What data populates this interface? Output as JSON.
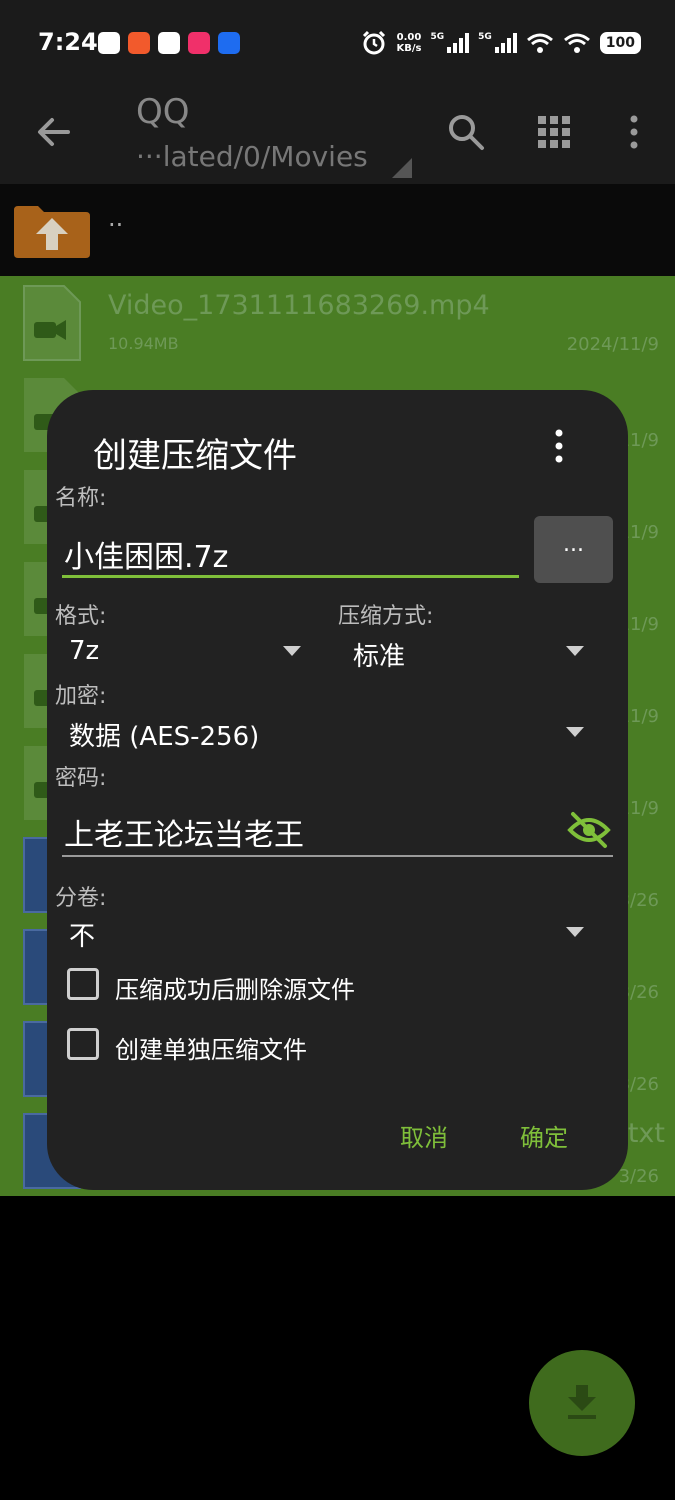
{
  "status_bar": {
    "time": "7:24",
    "net_speed_value": "0.00",
    "net_speed_unit": "KB/s",
    "signal1_label": "5G",
    "signal2_label": "5G",
    "battery": "100"
  },
  "toolbar": {
    "title": "QQ",
    "path": "···lated/0/Movies"
  },
  "file_list": {
    "parent_label": "..",
    "first_file": {
      "name": "Video_1731111683269.mp4",
      "size": "10.94MB",
      "date": "2024/11/9"
    },
    "partial_dates": [
      "11/9",
      "11/9",
      "11/9",
      "11/9",
      "11/9",
      "3/26",
      "3/26",
      "3/26",
      "3/26"
    ],
    "last_suffix": "txt"
  },
  "dialog": {
    "title": "创建压缩文件",
    "name_label": "名称:",
    "name_value": "小佳困困.7z",
    "browse_label": "...",
    "format_label": "格式:",
    "format_value": "7z",
    "method_label": "压缩方式:",
    "method_value": "标准",
    "encrypt_label": "加密:",
    "encrypt_value": "数据 (AES-256)",
    "password_label": "密码:",
    "password_value": "上老王论坛当老王",
    "split_label": "分卷:",
    "split_value": "不",
    "delete_source_label": "压缩成功后删除源文件",
    "delete_source_checked": false,
    "separate_archives_label": "创建单独压缩文件",
    "separate_archives_checked": false,
    "cancel_label": "取消",
    "ok_label": "确定"
  },
  "colors": {
    "accent": "#7fbf3a",
    "dialog_bg": "#222222",
    "list_highlight": "#4a7d24",
    "fab": "#3f6b1d"
  }
}
